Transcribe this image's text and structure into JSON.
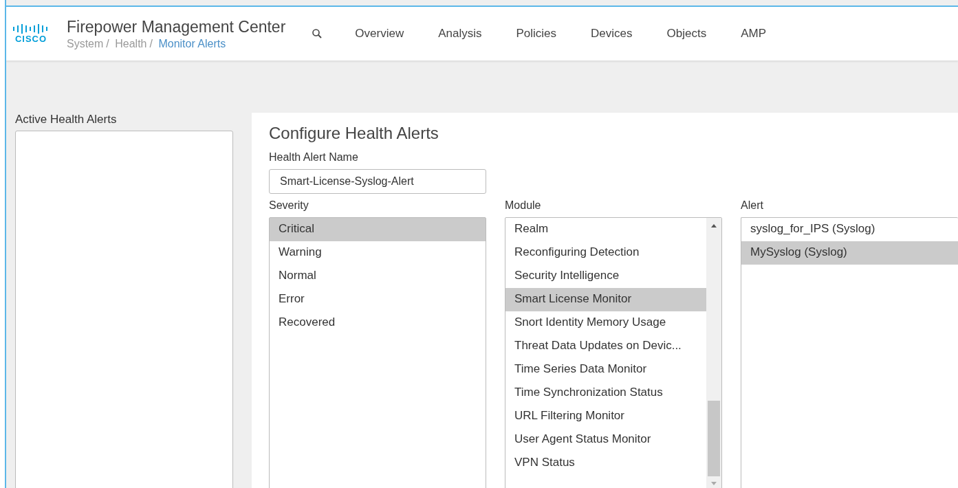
{
  "header": {
    "logo": "CISCO",
    "title": "Firepower Management Center",
    "breadcrumb": [
      {
        "label": "System",
        "current": false
      },
      {
        "label": "Health",
        "current": false
      },
      {
        "label": "Monitor Alerts",
        "current": true
      }
    ],
    "separator": "/",
    "nav": [
      "Overview",
      "Analysis",
      "Policies",
      "Devices",
      "Objects",
      "AMP"
    ]
  },
  "sidebar": {
    "title": "Active Health Alerts"
  },
  "form": {
    "title": "Configure Health Alerts",
    "name_label": "Health Alert Name",
    "name_value": "Smart-License-Syslog-Alert",
    "severity": {
      "label": "Severity",
      "items": [
        {
          "label": "Critical",
          "selected": true
        },
        {
          "label": "Warning",
          "selected": false
        },
        {
          "label": "Normal",
          "selected": false
        },
        {
          "label": "Error",
          "selected": false
        },
        {
          "label": "Recovered",
          "selected": false
        }
      ]
    },
    "module": {
      "label": "Module",
      "items": [
        {
          "label": "Realm",
          "selected": false
        },
        {
          "label": "Reconfiguring Detection",
          "selected": false
        },
        {
          "label": "Security Intelligence",
          "selected": false
        },
        {
          "label": "Smart License Monitor",
          "selected": true
        },
        {
          "label": "Snort Identity Memory Usage",
          "selected": false
        },
        {
          "label": "Threat Data Updates on Devic...",
          "selected": false
        },
        {
          "label": "Time Series Data Monitor",
          "selected": false
        },
        {
          "label": "Time Synchronization Status",
          "selected": false
        },
        {
          "label": "URL Filtering Monitor",
          "selected": false
        },
        {
          "label": "User Agent Status Monitor",
          "selected": false
        },
        {
          "label": "VPN Status",
          "selected": false
        }
      ]
    },
    "alert": {
      "label": "Alert",
      "items": [
        {
          "label": "syslog_for_IPS (Syslog)",
          "selected": false
        },
        {
          "label": "MySyslog (Syslog)",
          "selected": true
        }
      ]
    }
  }
}
